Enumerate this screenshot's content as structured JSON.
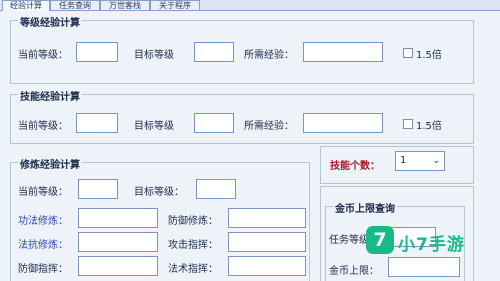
{
  "tabs": [
    "经验计算",
    "任务查询",
    "万世客栈",
    "关于程序"
  ],
  "level_exp": {
    "title": "等级经验计算",
    "current_label": "当前等级：",
    "target_label": "目标等级",
    "needed_label": "所需经验：",
    "multiplier_label": "1.5倍"
  },
  "skill_exp": {
    "title": "技能经验计算",
    "current_label": "当前等级：",
    "target_label": "目标等级",
    "needed_label": "所需经验：",
    "multiplier_label": "1.5倍"
  },
  "cultivation": {
    "title": "修炼经验计算",
    "current_label": "当前等级：",
    "target_label": "目标等级：",
    "rows": [
      {
        "left": "功法修炼：",
        "right": "防御修炼："
      },
      {
        "left": "法抗修炼：",
        "right": "攻击指挥："
      },
      {
        "left": "防御指挥：",
        "right": "法术指挥："
      }
    ]
  },
  "skill_count": {
    "label": "技能个数：",
    "value": "1"
  },
  "gold_cap": {
    "title": "金币上限查询",
    "task_level_label": "任务等级",
    "gold_cap_label": "金币上限："
  },
  "watermark": {
    "badge": "7",
    "text": "小7手游",
    "color": "#19b989"
  }
}
